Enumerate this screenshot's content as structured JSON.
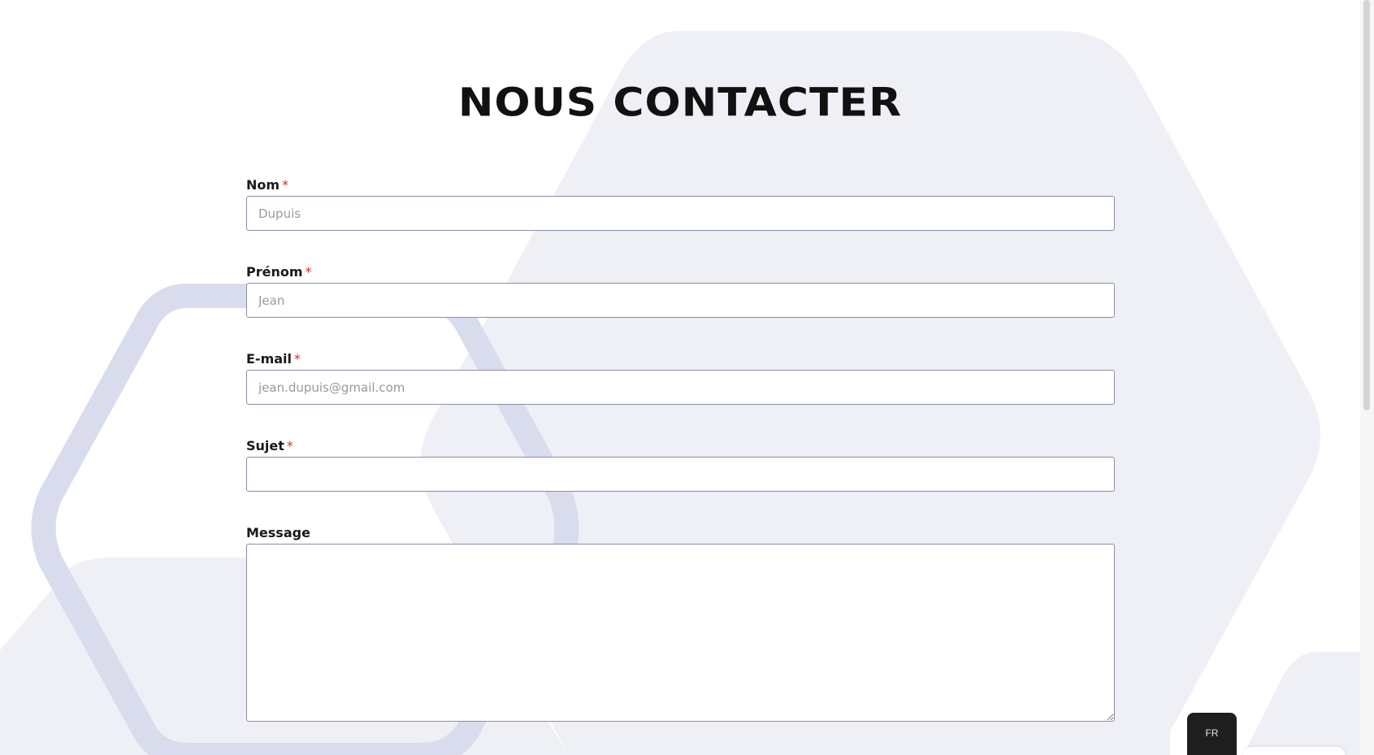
{
  "title": "NOUS CONTACTER",
  "form": {
    "nom": {
      "label": "Nom",
      "required": "*",
      "placeholder": "Dupuis",
      "value": ""
    },
    "prenom": {
      "label": "Prénom",
      "required": "*",
      "placeholder": "Jean",
      "value": ""
    },
    "email": {
      "label": "E-mail",
      "required": "*",
      "placeholder": "jean.dupuis@gmail.com",
      "value": ""
    },
    "sujet": {
      "label": "Sujet",
      "required": "*",
      "placeholder": "",
      "value": ""
    },
    "message": {
      "label": "Message",
      "value": ""
    }
  },
  "language": {
    "current": "FR"
  },
  "colors": {
    "title": "#111111",
    "required_marker": "#e0262f",
    "input_border": "#8a8fa8",
    "background_hex_light": "#eef0f6",
    "background_hex_outline": "#d8dcec",
    "lang_badge": "#1e1e1e"
  }
}
